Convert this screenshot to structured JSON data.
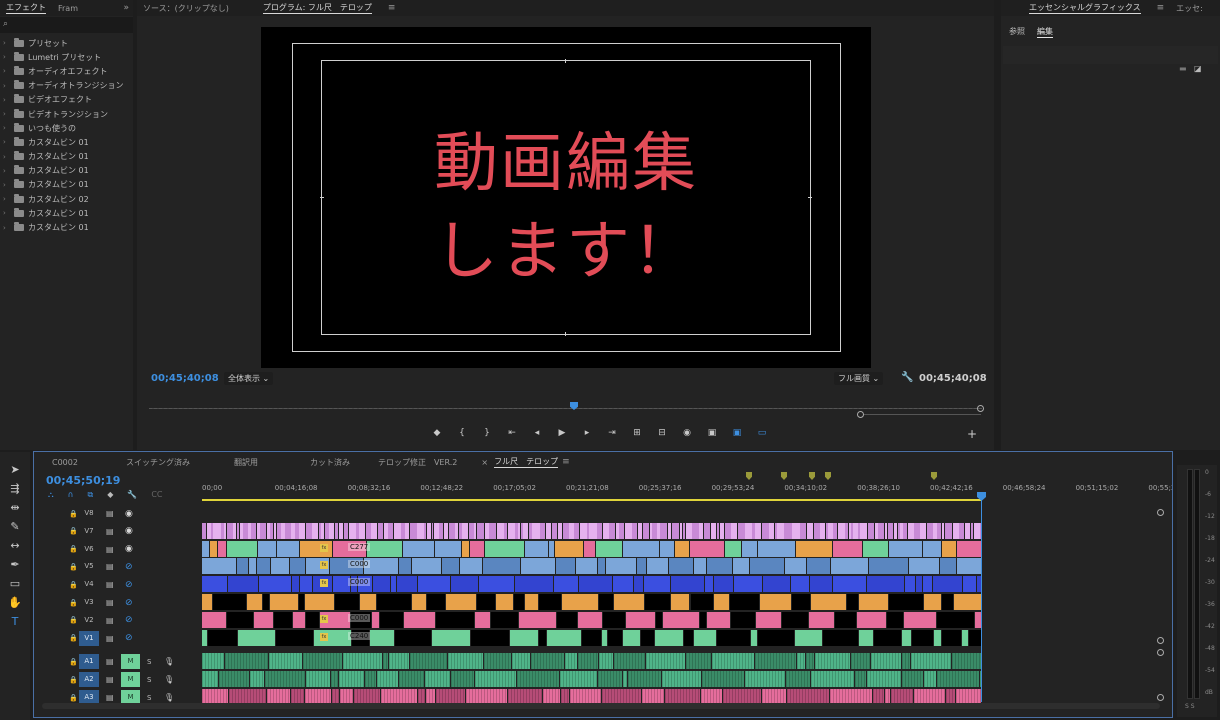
{
  "effects_panel": {
    "tabs": [
      "エフェクト",
      "Fram"
    ],
    "tree": [
      "プリセット",
      "Lumetri プリセット",
      "オーディオエフェクト",
      "オーディオトランジション",
      "ビデオエフェクト",
      "ビデオトランジション",
      "いつも使うの",
      "カスタムビン 01",
      "カスタムビン 01",
      "カスタムビン 01",
      "カスタムビン 01",
      "カスタムビン 02",
      "カスタムビン 01",
      "カスタムビン 01"
    ]
  },
  "program": {
    "tab_source": "ソース：(クリップなし)",
    "tab_program": "プログラム: フル尺　テロップ",
    "caption_line1": "動画編集",
    "caption_line2": "します！",
    "timecode_left": "00;45;40;08",
    "timecode_right": "00;45;40;08",
    "zoom": "全体表示",
    "quality": "フル画質"
  },
  "essentials": {
    "tabs": [
      "エッセンシャルグラフィックス",
      "エッセ:"
    ],
    "sub_tabs": [
      "参照",
      "編集"
    ]
  },
  "timeline": {
    "tabs": [
      "C0002",
      "スイッチング済み",
      "翻訳用",
      "カット済み",
      "テロップ修正　VER.2",
      "フル尺　テロップ"
    ],
    "timecode": "00;45;50;19",
    "ruler": [
      "00;00",
      "00;04;16;08",
      "00;08;32;16",
      "00;12;48;22",
      "00;17;05;02",
      "00;21;21;08",
      "00;25;37;16",
      "00;29;53;24",
      "00;34;10;02",
      "00;38;26;10",
      "00;42;42;16",
      "00;46;58;24",
      "00;51;15;02",
      "00;55;31"
    ],
    "video_tracks": [
      "V8",
      "V7",
      "V6",
      "V5",
      "V4",
      "V3",
      "V2",
      "V1"
    ],
    "audio_tracks": [
      "A1",
      "A2",
      "A3"
    ],
    "clip_labels": [
      "C277",
      "C000",
      "C000",
      "C000",
      "C240"
    ],
    "mute_label": "M",
    "solo_label": "S",
    "fx_label": "fx"
  },
  "meter": {
    "labels": [
      "0",
      "-6",
      "-12",
      "-18",
      "-24",
      "-30",
      "-36",
      "-42",
      "-48",
      "-54",
      "dB"
    ],
    "bottom_label": "S S"
  }
}
